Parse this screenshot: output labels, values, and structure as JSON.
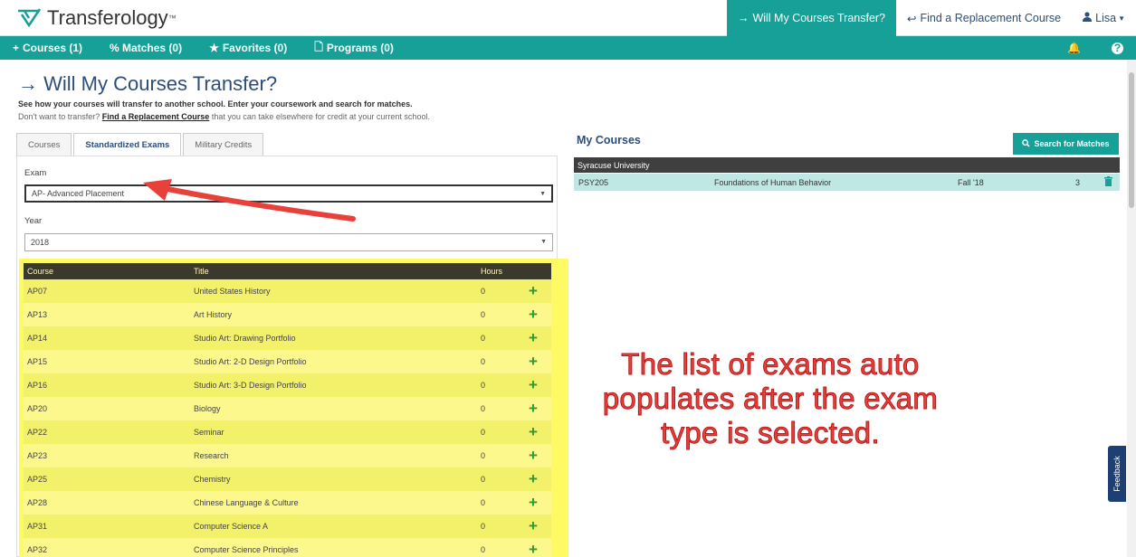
{
  "brand": {
    "name": "Transferology",
    "tm": "™"
  },
  "top_nav": {
    "will_transfer": "Will My Courses Transfer?",
    "find_replacement": "Find a Replacement Course",
    "user": "Lisa"
  },
  "nav": {
    "courses": "Courses (1)",
    "matches": "% Matches (0)",
    "favorites": "Favorites (0)",
    "programs": "Programs (0)"
  },
  "page": {
    "title": "Will My Courses Transfer?",
    "desc1": "See how your courses will transfer to another school. Enter your coursework and search for matches.",
    "desc2_pre": "Don't want to transfer?",
    "desc2_link": "Find a Replacement Course",
    "desc2_post": "that you can take elsewhere for credit at your current school."
  },
  "tabs": [
    "Courses",
    "Standardized Exams",
    "Military Credits"
  ],
  "form": {
    "exam_label": "Exam",
    "exam_value": "AP- Advanced Placement",
    "year_label": "Year",
    "year_value": "2018"
  },
  "grid": {
    "headers": [
      "Course",
      "Title",
      "Hours"
    ],
    "rows": [
      {
        "course": "AP07",
        "title": "United States History",
        "hours": "0"
      },
      {
        "course": "AP13",
        "title": "Art History",
        "hours": "0"
      },
      {
        "course": "AP14",
        "title": "Studio Art: Drawing Portfolio",
        "hours": "0"
      },
      {
        "course": "AP15",
        "title": "Studio Art: 2-D Design Portfolio",
        "hours": "0"
      },
      {
        "course": "AP16",
        "title": "Studio Art: 3-D Design Portfolio",
        "hours": "0"
      },
      {
        "course": "AP20",
        "title": "Biology",
        "hours": "0"
      },
      {
        "course": "AP22",
        "title": "Seminar",
        "hours": "0"
      },
      {
        "course": "AP23",
        "title": "Research",
        "hours": "0"
      },
      {
        "course": "AP25",
        "title": "Chemistry",
        "hours": "0"
      },
      {
        "course": "AP28",
        "title": "Chinese Language & Culture",
        "hours": "0"
      },
      {
        "course": "AP31",
        "title": "Computer Science A",
        "hours": "0"
      },
      {
        "course": "AP32",
        "title": "Computer Science Principles",
        "hours": "0"
      }
    ]
  },
  "my_courses": {
    "title": "My Courses",
    "search_button": "Search for Matches",
    "university": "Syracuse University",
    "course": {
      "code": "PSY205",
      "title": "Foundations of Human Behavior",
      "term": "Fall '18",
      "hours": "3"
    }
  },
  "annotation": {
    "line1": "The list of exams auto",
    "line2": "populates after the exam",
    "line3": "type is selected."
  },
  "feedback": "Feedback",
  "colors": {
    "teal": "#16a097",
    "navy": "#2d4d7a",
    "highlight": "#fdfa63",
    "annotation": "#e8413c"
  }
}
